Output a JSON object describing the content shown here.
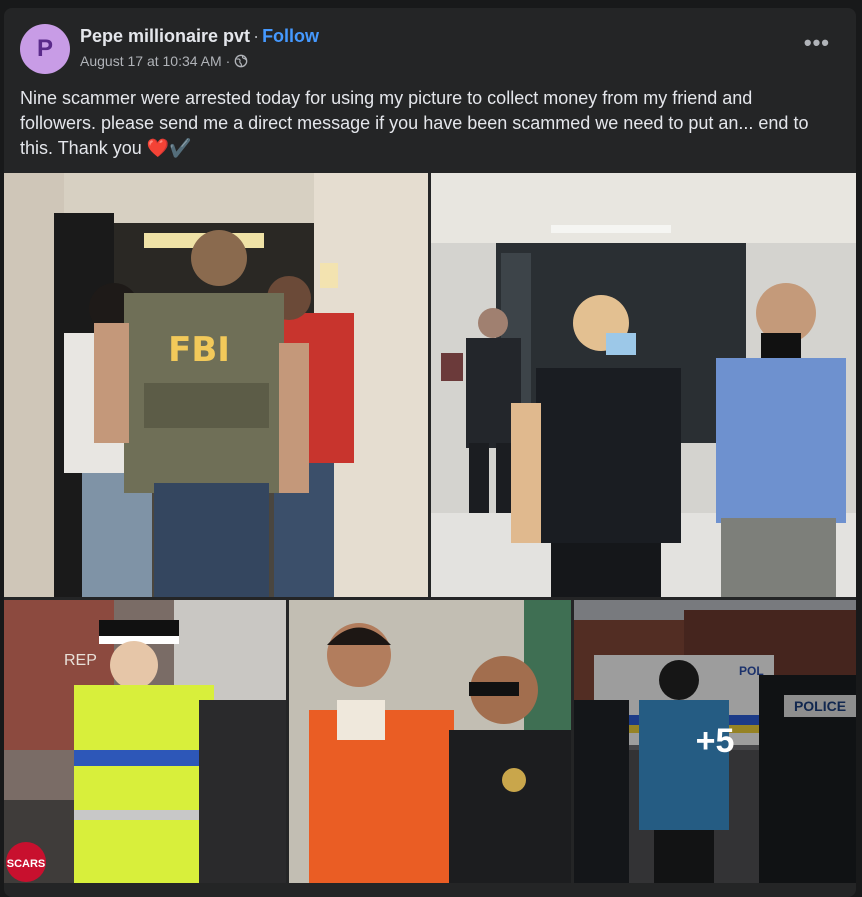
{
  "post": {
    "author_initial": "P",
    "author_name": "Pepe millionaire pvt",
    "follow_label": "Follow",
    "timestamp": "August 17 at 10:34 AM",
    "privacy_icon": "globe-icon",
    "more_label": "•••",
    "text": "Nine scammer were arrested today for using my picture to collect money from my friend and followers. please send me a direct message if you have been scammed we need to put an... end to this. Thank you",
    "emoji_heart": "❤️",
    "emoji_check": "✔️"
  },
  "photos": {
    "fbi_label": "FBI",
    "police_label": "POLICE",
    "van_label": "POL",
    "scars_badge": "SCARS",
    "more_count": "+5"
  },
  "colors": {
    "background": "#18191a",
    "card": "#242526",
    "text": "#e4e6eb",
    "secondary": "#b0b3b8",
    "link": "#4599ff",
    "avatar": "#c89ce6"
  }
}
